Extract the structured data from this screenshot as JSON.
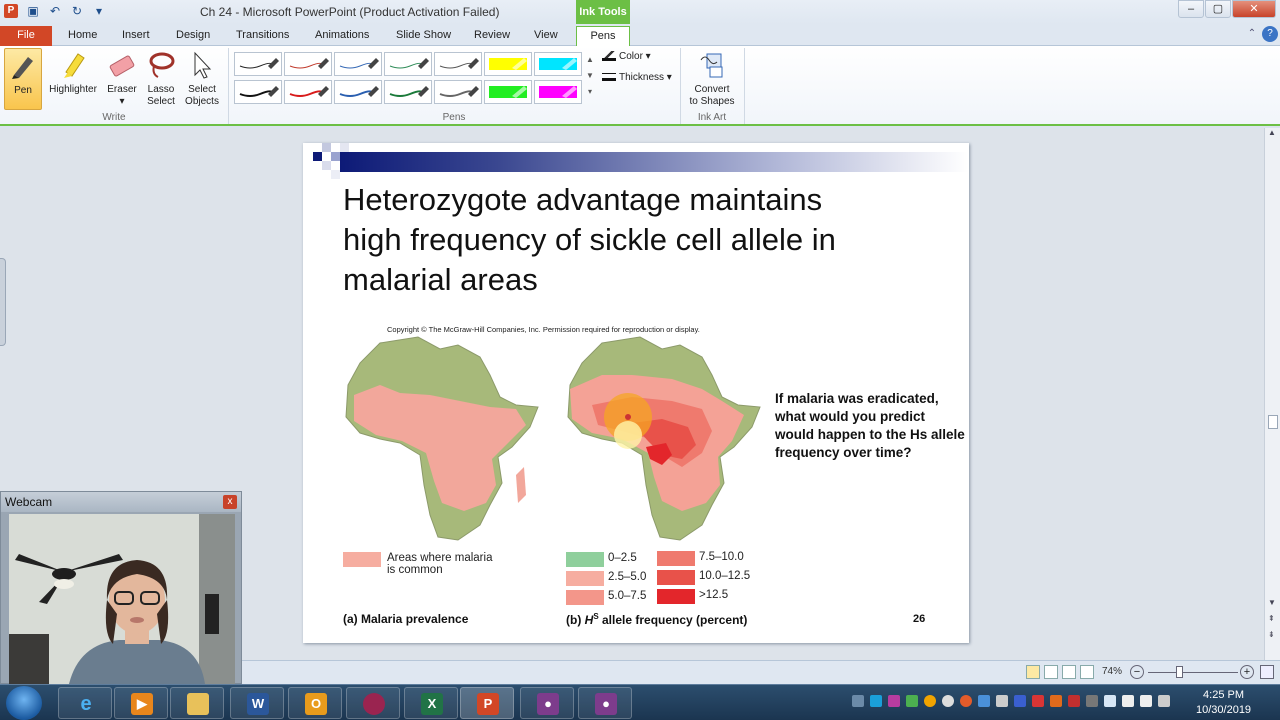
{
  "window": {
    "title": "Ch 24  -  Microsoft PowerPoint (Product Activation Failed)",
    "contextual_tab_group": "Ink Tools",
    "controls": [
      "–",
      "▢",
      "✕"
    ]
  },
  "tabs": {
    "file": "File",
    "items": [
      "Home",
      "Insert",
      "Design",
      "Transitions",
      "Animations",
      "Slide Show",
      "Review",
      "View",
      "Pens"
    ],
    "active": "Pens"
  },
  "ribbon": {
    "write": {
      "label": "Write",
      "pen": "Pen",
      "highlighter": "Highlighter",
      "eraser": "Eraser",
      "lasso": "Lasso Select",
      "select": "Select Objects"
    },
    "pens": {
      "label": "Pens",
      "colors": [
        "#222222",
        "#c0392b",
        "#3568b5",
        "#2e8b57",
        "#555555",
        "#ffff00",
        "#00e5ff",
        "#111111",
        "#d81b1b",
        "#2a5fb0",
        "#1b7a3a",
        "#666666",
        "#22ee22",
        "#ff00ff"
      ],
      "color_label": "Color",
      "thickness_label": "Thickness"
    },
    "ink_art": {
      "label": "Ink Art",
      "convert_line1": "Convert",
      "convert_line2": "to Shapes"
    }
  },
  "slide": {
    "title_line1": "Heterozygote advantage maintains",
    "title_line2": "high frequency of sickle cell allele in",
    "title_line3": "malarial areas",
    "copyright": "Copyright © The McGraw-Hill Companies, Inc. Permission required for reproduction or display.",
    "question": "If malaria was eradicated, what would you predict would happen to the Hs allele frequency over time?",
    "legend_a_line1": "Areas where malaria",
    "legend_a_line2": "is common",
    "legend_b": [
      "0–2.5",
      "2.5–5.0",
      "5.0–7.5",
      "7.5–10.0",
      "10.0–12.5",
      ">12.5"
    ],
    "legend_b_colors": [
      "#8fcf9c",
      "#f6ada0",
      "#f3968a",
      "#ef7a6e",
      "#e8524a",
      "#e3262b"
    ],
    "legend_a_color": "#f6ada0",
    "caption_a": "(a) Malaria prevalence",
    "caption_b_prefix": "(b) ",
    "caption_b_h": "H",
    "caption_b_s": "S",
    "caption_b_suffix": " allele frequency (percent)",
    "slide_number": "26"
  },
  "webcam": {
    "title": "Webcam",
    "close": "x"
  },
  "statusbar": {
    "zoom": "74%"
  },
  "taskbar": {
    "time": "4:25 PM",
    "date": "10/30/2019"
  }
}
